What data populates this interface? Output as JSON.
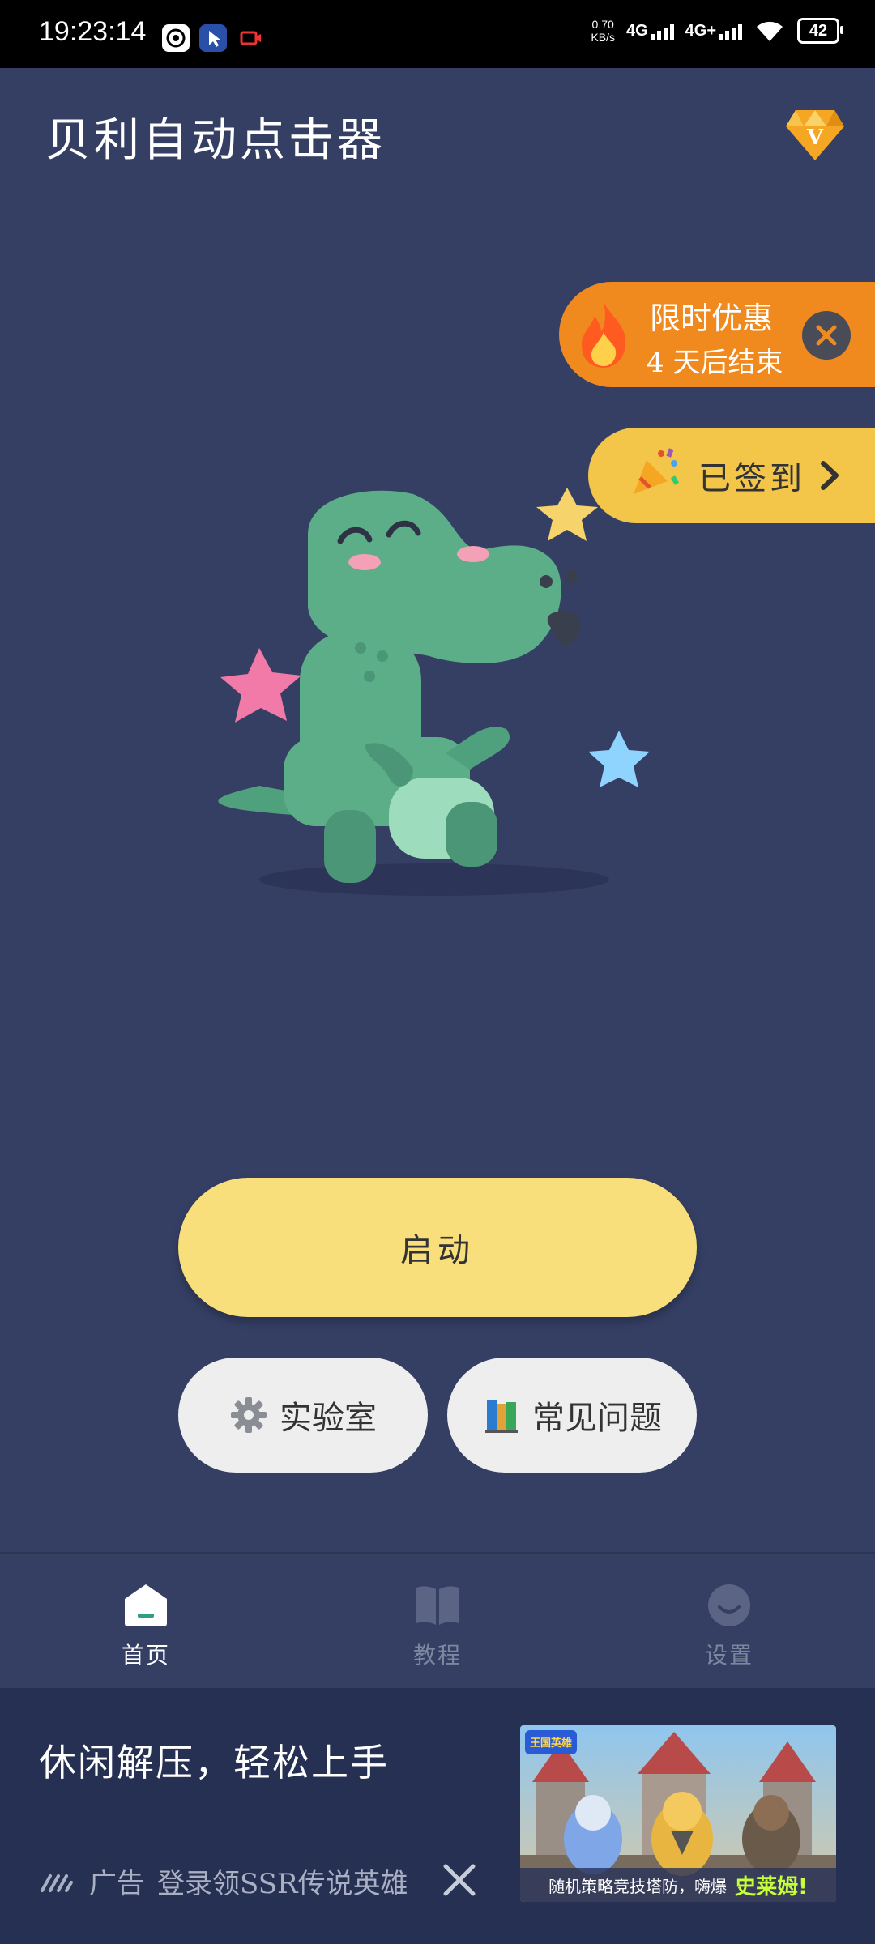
{
  "status_bar": {
    "time": "19:23:14",
    "speed_value": "0.70",
    "speed_unit": "KB/s",
    "network1": "4G",
    "network2": "4G+",
    "battery": "42"
  },
  "header": {
    "title": "贝利自动点击器"
  },
  "promo": {
    "line1": "限时优惠",
    "line2": "4 天后结束"
  },
  "signin": {
    "label": "已签到"
  },
  "main": {
    "start_label": "启动",
    "lab_label": "实验室",
    "faq_label": "常见问题"
  },
  "nav": {
    "items": [
      {
        "label": "首页",
        "icon": "home-icon",
        "active": true
      },
      {
        "label": "教程",
        "icon": "book-icon",
        "active": false
      },
      {
        "label": "设置",
        "icon": "smile-icon",
        "active": false
      }
    ]
  },
  "ad": {
    "headline": "休闲解压，轻松上手",
    "tag": "广告",
    "description": "登录领SSR传说英雄",
    "image_caption": "随机策略竞技塔防，嗨爆",
    "image_highlight": "史莱姆!",
    "image_logo": "王国英雄"
  },
  "colors": {
    "background": "#353f64",
    "start_button": "#f9df7b",
    "promo": "#f08a1f",
    "signin": "#f3c64a",
    "ad_background": "#263052"
  }
}
